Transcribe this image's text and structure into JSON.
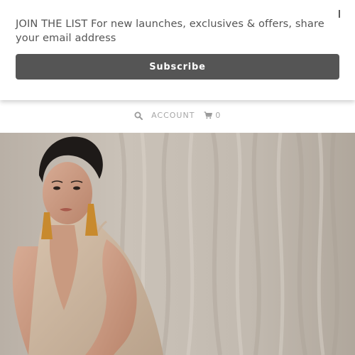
{
  "popup": {
    "text": "JOIN THE LIST For new launches, exclusives & offers, share your email address",
    "close_label": "I",
    "subscribe_label": "Subscribe"
  },
  "header": {
    "search_icon": "search-icon",
    "account_label": "ACCOUNT",
    "cart_icon": "cart-icon",
    "cart_count": "0"
  },
  "colors": {
    "button": "#555555",
    "nav_text": "#a6a6a6",
    "popup_text": "#555555"
  }
}
